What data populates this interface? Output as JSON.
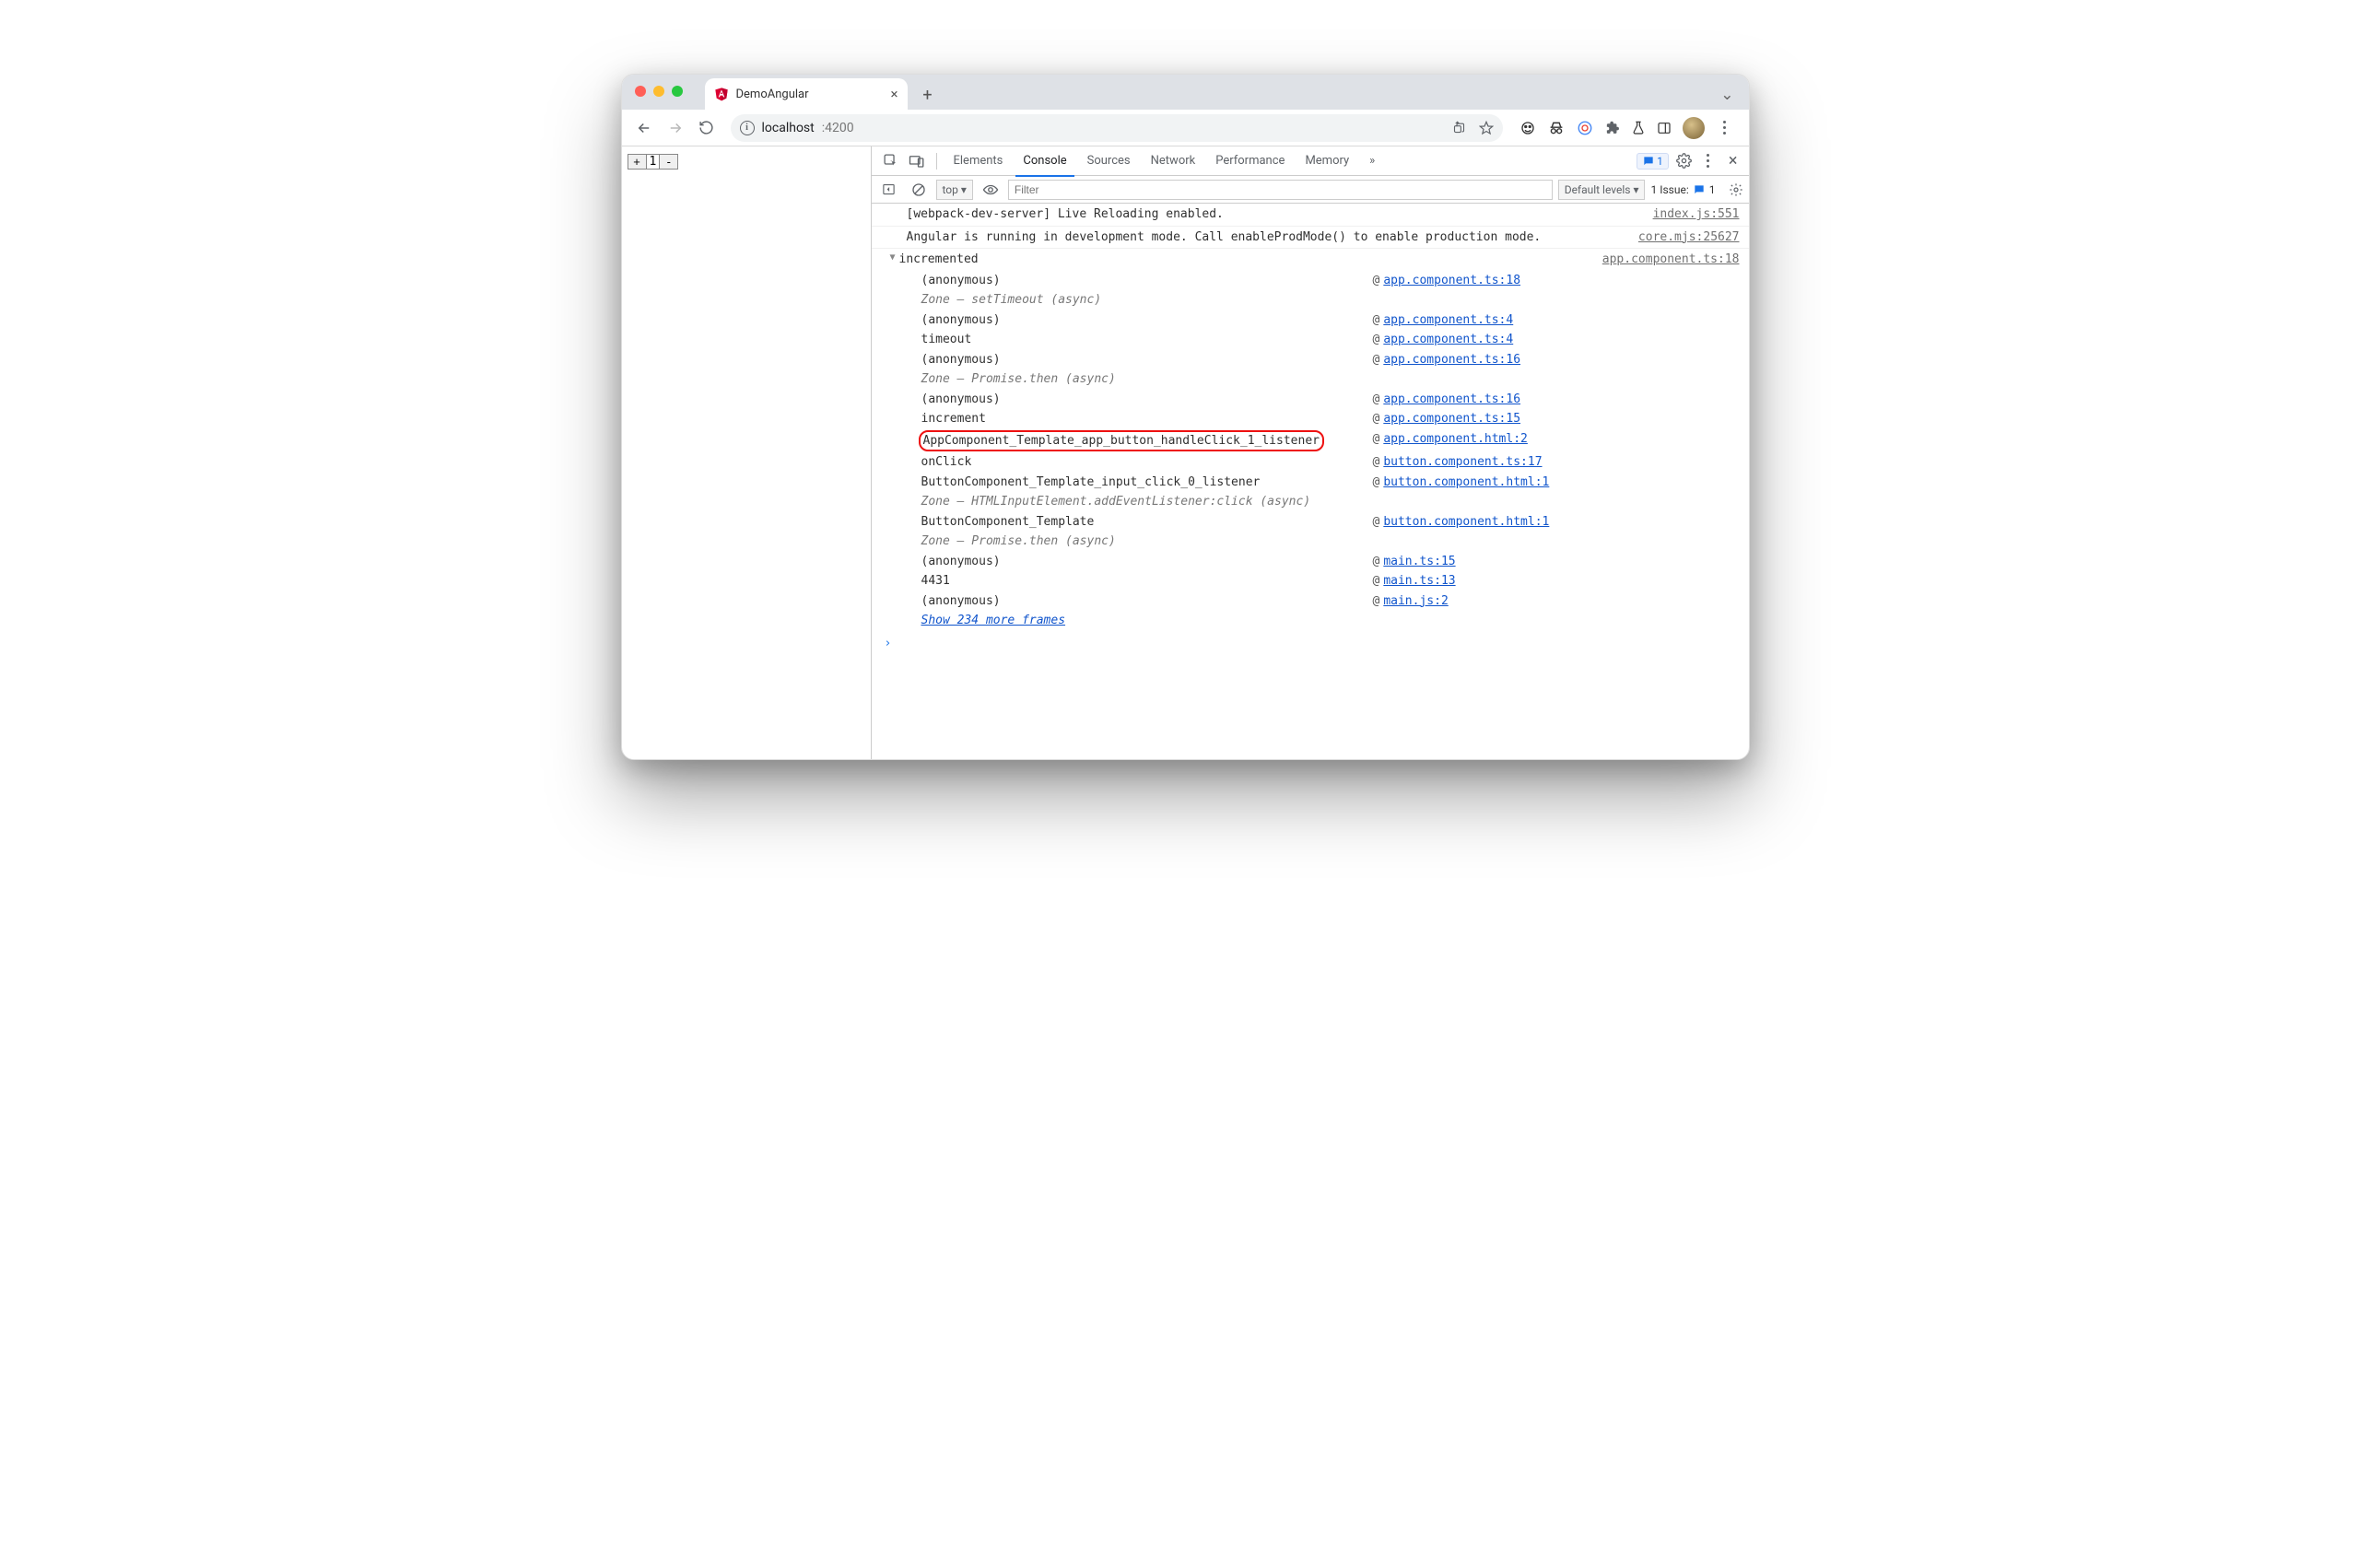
{
  "tab": {
    "title": "DemoAngular"
  },
  "url": {
    "host": "localhost",
    "port": ":4200"
  },
  "page": {
    "counter_value": "1"
  },
  "devtools": {
    "tabs": [
      "Elements",
      "Console",
      "Sources",
      "Network",
      "Performance",
      "Memory"
    ],
    "active_tab": "Console",
    "badge_count": "1",
    "console_bar": {
      "context": "top ▾",
      "filter_placeholder": "Filter",
      "levels": "Default levels ▾",
      "issue_label": "1 Issue:",
      "issue_count": "1"
    }
  },
  "log": {
    "r0": {
      "msg": "[webpack-dev-server] Live Reloading enabled.",
      "src": "index.js:551"
    },
    "r1": {
      "msg": "Angular is running in development mode. Call enableProdMode() to enable production mode.",
      "src": "core.mjs:25627"
    },
    "r2": {
      "msg": "incremented",
      "src": "app.component.ts:18"
    }
  },
  "stack": [
    {
      "fn": "(anonymous)",
      "link": "app.component.ts:18"
    },
    {
      "fn": "Zone — setTimeout (async)",
      "zone": true
    },
    {
      "fn": "(anonymous)",
      "link": "app.component.ts:4"
    },
    {
      "fn": "timeout",
      "link": "app.component.ts:4"
    },
    {
      "fn": "(anonymous)",
      "link": "app.component.ts:16"
    },
    {
      "fn": "Zone — Promise.then (async)",
      "zone": true
    },
    {
      "fn": "(anonymous)",
      "link": "app.component.ts:16"
    },
    {
      "fn": "increment",
      "link": "app.component.ts:15"
    },
    {
      "fn": "AppComponent_Template_app_button_handleClick_1_listener",
      "link": "app.component.html:2",
      "highlight": true
    },
    {
      "fn": "onClick",
      "link": "button.component.ts:17"
    },
    {
      "fn": "ButtonComponent_Template_input_click_0_listener",
      "link": "button.component.html:1"
    },
    {
      "fn": "Zone — HTMLInputElement.addEventListener:click (async)",
      "zone": true
    },
    {
      "fn": "ButtonComponent_Template",
      "link": "button.component.html:1"
    },
    {
      "fn": "Zone — Promise.then (async)",
      "zone": true
    },
    {
      "fn": "(anonymous)",
      "link": "main.ts:15"
    },
    {
      "fn": "4431",
      "link": "main.ts:13"
    },
    {
      "fn": "(anonymous)",
      "link": "main.js:2"
    }
  ],
  "show_more": "Show 234 more frames"
}
